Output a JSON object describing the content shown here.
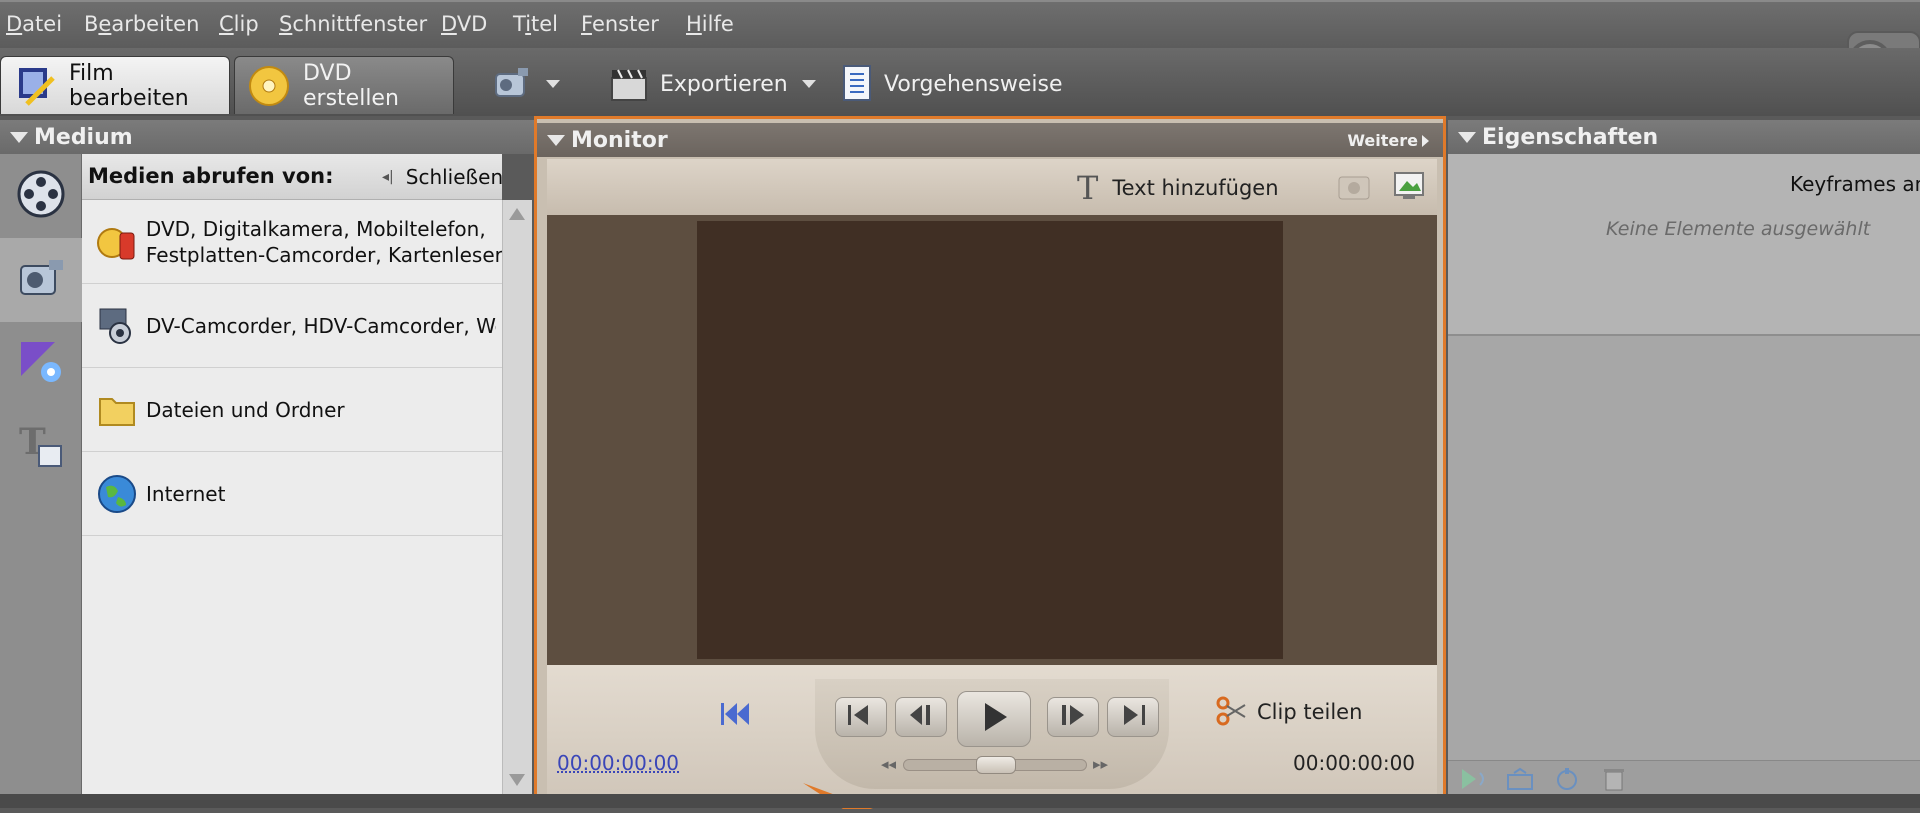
{
  "menu": {
    "items": [
      {
        "pre": "",
        "u": "D",
        "post": "atei"
      },
      {
        "pre": "B",
        "u": "e",
        "post": "arbeiten"
      },
      {
        "pre": "",
        "u": "C",
        "post": "lip"
      },
      {
        "pre": "",
        "u": "S",
        "post": "chnittfenster"
      },
      {
        "pre": "",
        "u": "D",
        "post": "VD"
      },
      {
        "pre": "T",
        "u": "i",
        "post": "tel"
      },
      {
        "pre": "",
        "u": "F",
        "post": "enster"
      },
      {
        "pre": "",
        "u": "H",
        "post": "ilfe"
      }
    ]
  },
  "toolbar": {
    "tab_film": "Film bearbeiten",
    "tab_dvd": "DVD erstellen",
    "export_label": "Exportieren",
    "howto_label": "Vorgehensweise"
  },
  "medium": {
    "title": "Medium",
    "header": "Medien abrufen von:",
    "close_label": "Schließen",
    "rows": [
      {
        "line1": "DVD, Digitalkamera, Mobiltelefon,",
        "line2": "Festplatten-Camcorder, Kartenleser",
        "icon": "dvd-camera-phone-icon"
      },
      {
        "line1": "DV-Camcorder, HDV-Camcorder, Webcam",
        "line2": "",
        "icon": "webcam-icon"
      },
      {
        "line1": "Dateien und Ordner",
        "line2": "",
        "icon": "folder-icon"
      },
      {
        "line1": "Internet",
        "line2": "",
        "icon": "globe-icon"
      }
    ]
  },
  "monitor": {
    "title": "Monitor",
    "more_label": "Weitere",
    "add_text_label": "Text hinzufügen",
    "split_label": "Clip teilen",
    "timecode_current": "00:00:00:00",
    "timecode_total": "00:00:00:00"
  },
  "properties": {
    "title": "Eigenschaften",
    "keyframes_label": "Keyframes an",
    "empty_label": "Keine Elemente ausgewählt"
  },
  "colors": {
    "accent": "#e07a2a"
  }
}
